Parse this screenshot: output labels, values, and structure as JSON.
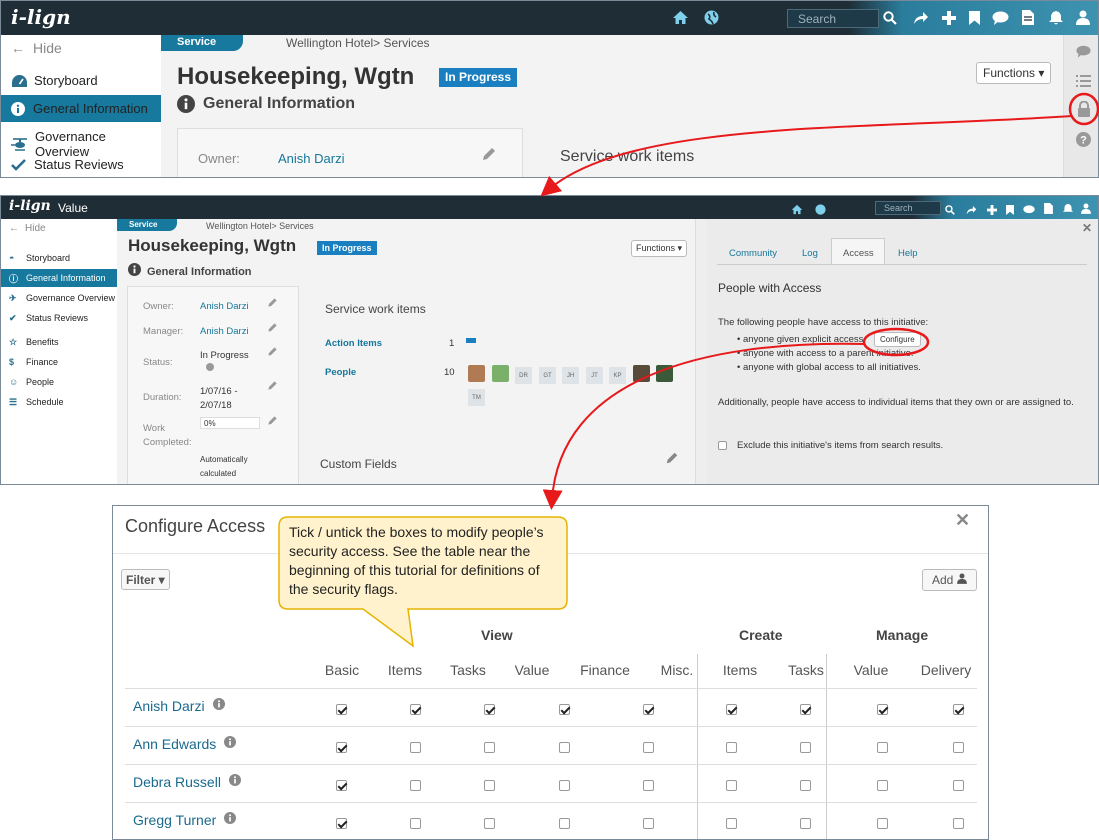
{
  "panel1": {
    "logo": "i-lign",
    "search_placeholder": "Search",
    "sidebar": {
      "hide": "Hide",
      "items": [
        "Storyboard",
        "General Information",
        "Governance Overview",
        "Status Reviews"
      ]
    },
    "tab": "Service",
    "breadcrumb": "Wellington Hotel> Services",
    "title": "Housekeeping, Wgtn",
    "status": "In Progress",
    "section": "General Information",
    "functions": "Functions",
    "owner_label": "Owner:",
    "owner_value": "Anish Darzi",
    "service_work_items": "Service work items"
  },
  "panel2": {
    "logo": "i-lign",
    "app_title": "Value",
    "search_placeholder": "Search",
    "sidebar": {
      "hide": "Hide",
      "items": [
        "Storyboard",
        "General Information",
        "Governance Overview",
        "Status Reviews",
        "Benefits",
        "Finance",
        "People",
        "Schedule"
      ]
    },
    "tab": "Service",
    "breadcrumb": "Wellington Hotel> Services",
    "title": "Housekeeping, Wgtn",
    "status": "In Progress",
    "section": "General Information",
    "functions": "Functions",
    "fields": {
      "owner_label": "Owner:",
      "owner_value": "Anish Darzi",
      "manager_label": "Manager:",
      "manager_value": "Anish Darzi",
      "status_label": "Status:",
      "status_value": "In Progress",
      "duration_label": "Duration:",
      "duration_value": "1/07/16 -\n2/07/18",
      "work_label": "Work\nCompleted:",
      "work_value": "0%",
      "auto_note": "Automatically\ncalculated"
    },
    "service_work_items": "Service work items",
    "action_items_label": "Action Items",
    "action_items_count": "1",
    "people_label": "People",
    "people_count": "10",
    "people_initials": [
      "DR",
      "GT",
      "JH",
      "JT",
      "KP",
      "TM"
    ],
    "custom_fields": "Custom Fields",
    "right_tabs": [
      "Community",
      "Log",
      "Access",
      "Help"
    ],
    "people_with_access": "People with Access",
    "access_intro": "The following people have access to this initiative:",
    "access_bullets": [
      "anyone given explicit access",
      "anyone with access to a parent initiative.",
      "anyone with global access to all initiatives."
    ],
    "configure": "Configure",
    "additionally": "Additionally, people have access to individual items that they own or are assigned to.",
    "exclude": "Exclude this initiative's items from search results."
  },
  "dialog": {
    "title": "Configure Access",
    "filter": "Filter",
    "add": "Add",
    "callout": "Tick / untick the boxes to modify people’s security access.  See the table near the beginning of this tutorial for definitions of the security flags.",
    "group_view": "View",
    "group_create": "Create",
    "group_manage": "Manage",
    "columns": [
      "Basic",
      "Items",
      "Tasks",
      "Value",
      "Finance",
      "Misc.",
      "Items",
      "Tasks",
      "Value",
      "Delivery"
    ],
    "rows": [
      {
        "name": "Anish Darzi",
        "checks": [
          true,
          true,
          true,
          true,
          true,
          true,
          true,
          true,
          true,
          true
        ]
      },
      {
        "name": "Ann Edwards",
        "checks": [
          true,
          false,
          false,
          false,
          false,
          false,
          false,
          false,
          false,
          false
        ]
      },
      {
        "name": "Debra Russell",
        "checks": [
          true,
          false,
          false,
          false,
          false,
          false,
          false,
          false,
          false,
          false
        ]
      },
      {
        "name": "Gregg Turner",
        "checks": [
          true,
          false,
          false,
          false,
          false,
          false,
          false,
          false,
          false,
          false
        ]
      }
    ]
  },
  "colors": {
    "topbar": "#1f2d36",
    "teal": "#17799d",
    "badge": "#1a7fc1",
    "arrow": "#e8191b",
    "callout": "#fff2cc"
  }
}
